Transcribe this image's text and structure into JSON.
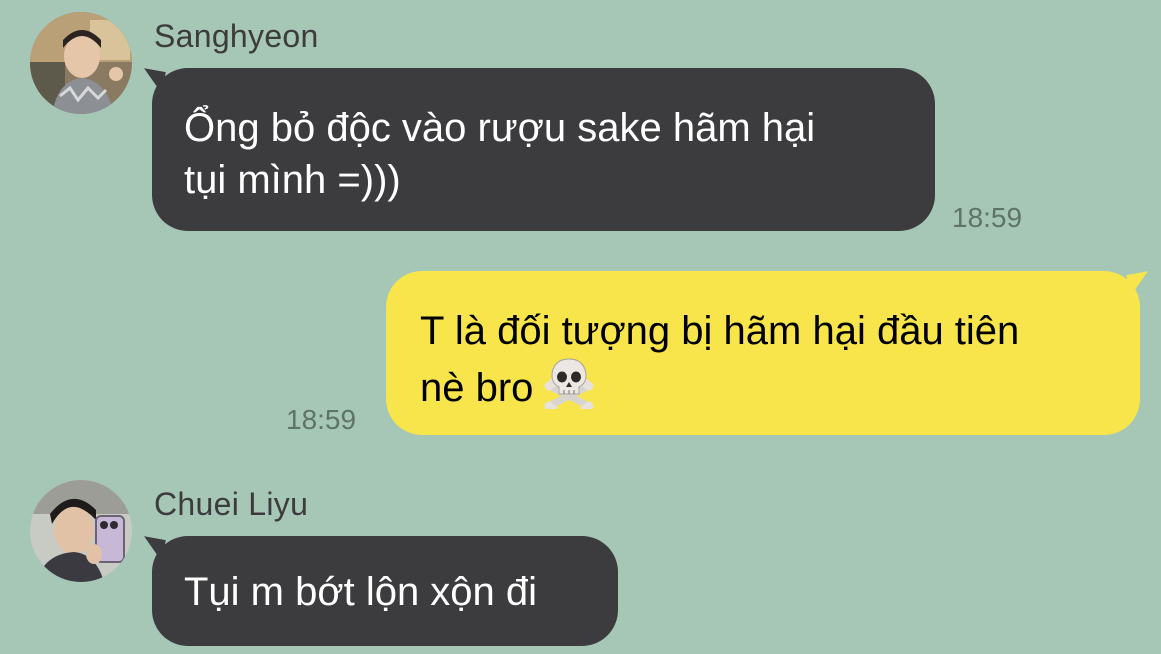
{
  "colors": {
    "background": "#a6c6b6",
    "incoming_bubble": "#3c3b3d",
    "outgoing_bubble": "#f8e54b",
    "timestamp": "#5f7468"
  },
  "messages": [
    {
      "sender": "Sanghyeon",
      "avatar": "sanghyeon-avatar",
      "line1": "Ổng bỏ độc vào rượu sake hãm hại",
      "line2": "tụi mình =)))",
      "time": "18:59"
    },
    {
      "sender": "me",
      "line1": "T là đối tượng bị hãm hại đầu tiên",
      "line2": "nè bro",
      "emoji": "skull-crossbones-icon",
      "time": "18:59"
    },
    {
      "sender": "Chuei Liyu",
      "avatar": "chuei-liyu-avatar",
      "line1": "Tụi m bớt lộn xộn đi"
    }
  ]
}
